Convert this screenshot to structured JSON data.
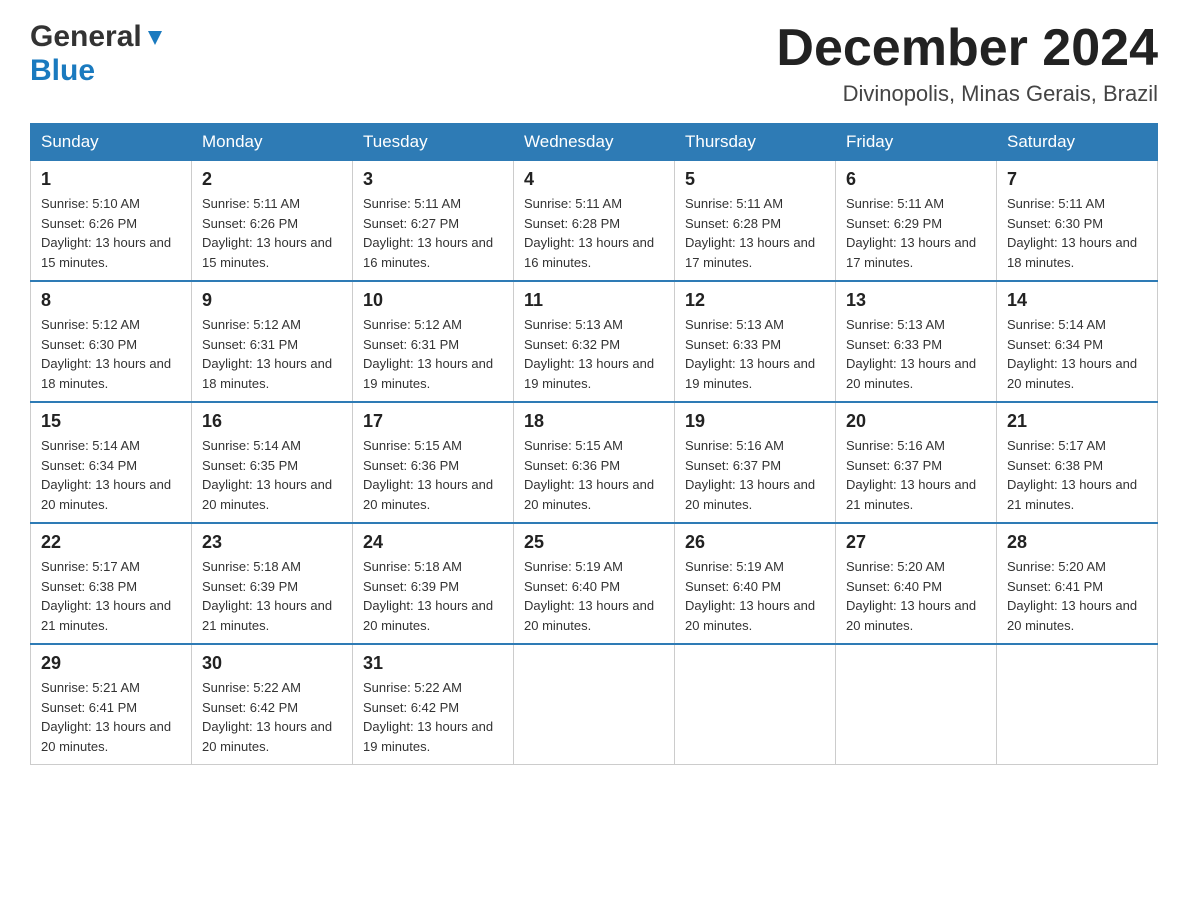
{
  "header": {
    "logo_general": "General",
    "logo_blue": "Blue",
    "month_title": "December 2024",
    "location": "Divinopolis, Minas Gerais, Brazil"
  },
  "days_of_week": [
    "Sunday",
    "Monday",
    "Tuesday",
    "Wednesday",
    "Thursday",
    "Friday",
    "Saturday"
  ],
  "weeks": [
    [
      {
        "day": "1",
        "sunrise": "5:10 AM",
        "sunset": "6:26 PM",
        "daylight": "13 hours and 15 minutes."
      },
      {
        "day": "2",
        "sunrise": "5:11 AM",
        "sunset": "6:26 PM",
        "daylight": "13 hours and 15 minutes."
      },
      {
        "day": "3",
        "sunrise": "5:11 AM",
        "sunset": "6:27 PM",
        "daylight": "13 hours and 16 minutes."
      },
      {
        "day": "4",
        "sunrise": "5:11 AM",
        "sunset": "6:28 PM",
        "daylight": "13 hours and 16 minutes."
      },
      {
        "day": "5",
        "sunrise": "5:11 AM",
        "sunset": "6:28 PM",
        "daylight": "13 hours and 17 minutes."
      },
      {
        "day": "6",
        "sunrise": "5:11 AM",
        "sunset": "6:29 PM",
        "daylight": "13 hours and 17 minutes."
      },
      {
        "day": "7",
        "sunrise": "5:11 AM",
        "sunset": "6:30 PM",
        "daylight": "13 hours and 18 minutes."
      }
    ],
    [
      {
        "day": "8",
        "sunrise": "5:12 AM",
        "sunset": "6:30 PM",
        "daylight": "13 hours and 18 minutes."
      },
      {
        "day": "9",
        "sunrise": "5:12 AM",
        "sunset": "6:31 PM",
        "daylight": "13 hours and 18 minutes."
      },
      {
        "day": "10",
        "sunrise": "5:12 AM",
        "sunset": "6:31 PM",
        "daylight": "13 hours and 19 minutes."
      },
      {
        "day": "11",
        "sunrise": "5:13 AM",
        "sunset": "6:32 PM",
        "daylight": "13 hours and 19 minutes."
      },
      {
        "day": "12",
        "sunrise": "5:13 AM",
        "sunset": "6:33 PM",
        "daylight": "13 hours and 19 minutes."
      },
      {
        "day": "13",
        "sunrise": "5:13 AM",
        "sunset": "6:33 PM",
        "daylight": "13 hours and 20 minutes."
      },
      {
        "day": "14",
        "sunrise": "5:14 AM",
        "sunset": "6:34 PM",
        "daylight": "13 hours and 20 minutes."
      }
    ],
    [
      {
        "day": "15",
        "sunrise": "5:14 AM",
        "sunset": "6:34 PM",
        "daylight": "13 hours and 20 minutes."
      },
      {
        "day": "16",
        "sunrise": "5:14 AM",
        "sunset": "6:35 PM",
        "daylight": "13 hours and 20 minutes."
      },
      {
        "day": "17",
        "sunrise": "5:15 AM",
        "sunset": "6:36 PM",
        "daylight": "13 hours and 20 minutes."
      },
      {
        "day": "18",
        "sunrise": "5:15 AM",
        "sunset": "6:36 PM",
        "daylight": "13 hours and 20 minutes."
      },
      {
        "day": "19",
        "sunrise": "5:16 AM",
        "sunset": "6:37 PM",
        "daylight": "13 hours and 20 minutes."
      },
      {
        "day": "20",
        "sunrise": "5:16 AM",
        "sunset": "6:37 PM",
        "daylight": "13 hours and 21 minutes."
      },
      {
        "day": "21",
        "sunrise": "5:17 AM",
        "sunset": "6:38 PM",
        "daylight": "13 hours and 21 minutes."
      }
    ],
    [
      {
        "day": "22",
        "sunrise": "5:17 AM",
        "sunset": "6:38 PM",
        "daylight": "13 hours and 21 minutes."
      },
      {
        "day": "23",
        "sunrise": "5:18 AM",
        "sunset": "6:39 PM",
        "daylight": "13 hours and 21 minutes."
      },
      {
        "day": "24",
        "sunrise": "5:18 AM",
        "sunset": "6:39 PM",
        "daylight": "13 hours and 20 minutes."
      },
      {
        "day": "25",
        "sunrise": "5:19 AM",
        "sunset": "6:40 PM",
        "daylight": "13 hours and 20 minutes."
      },
      {
        "day": "26",
        "sunrise": "5:19 AM",
        "sunset": "6:40 PM",
        "daylight": "13 hours and 20 minutes."
      },
      {
        "day": "27",
        "sunrise": "5:20 AM",
        "sunset": "6:40 PM",
        "daylight": "13 hours and 20 minutes."
      },
      {
        "day": "28",
        "sunrise": "5:20 AM",
        "sunset": "6:41 PM",
        "daylight": "13 hours and 20 minutes."
      }
    ],
    [
      {
        "day": "29",
        "sunrise": "5:21 AM",
        "sunset": "6:41 PM",
        "daylight": "13 hours and 20 minutes."
      },
      {
        "day": "30",
        "sunrise": "5:22 AM",
        "sunset": "6:42 PM",
        "daylight": "13 hours and 20 minutes."
      },
      {
        "day": "31",
        "sunrise": "5:22 AM",
        "sunset": "6:42 PM",
        "daylight": "13 hours and 19 minutes."
      },
      null,
      null,
      null,
      null
    ]
  ]
}
